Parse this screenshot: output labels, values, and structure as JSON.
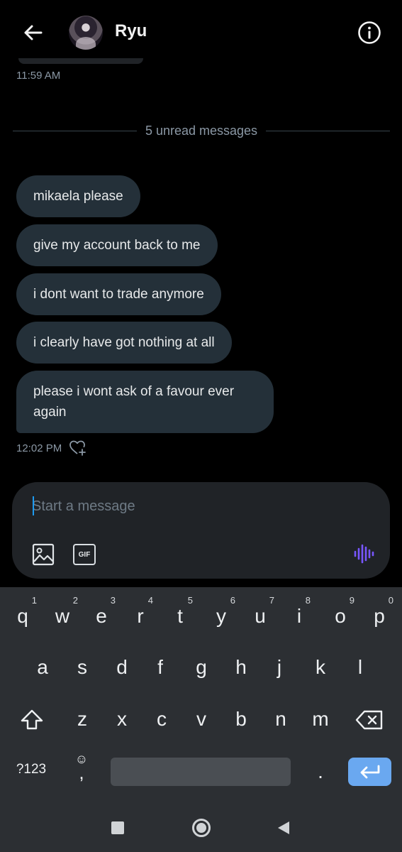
{
  "header": {
    "contact_name": "Ryu",
    "back_icon": "arrow-left-icon",
    "info_icon": "info-icon"
  },
  "conversation": {
    "previous_timestamp": "11:59 AM",
    "unread_divider": "5 unread messages",
    "messages": [
      "mikaela please",
      "give my account back to me",
      "i dont want to trade anymore",
      "i clearly have got nothing at all",
      "please i wont ask of a favour ever again"
    ],
    "last_timestamp": "12:02 PM"
  },
  "composer": {
    "placeholder": "Start a message",
    "gif_label": "GIF",
    "voice_color": "#7856ff"
  },
  "keyboard": {
    "row1": [
      {
        "key": "q",
        "hint": "1"
      },
      {
        "key": "w",
        "hint": "2"
      },
      {
        "key": "e",
        "hint": "3"
      },
      {
        "key": "r",
        "hint": "4"
      },
      {
        "key": "t",
        "hint": "5"
      },
      {
        "key": "y",
        "hint": "6"
      },
      {
        "key": "u",
        "hint": "7"
      },
      {
        "key": "i",
        "hint": "8"
      },
      {
        "key": "o",
        "hint": "9"
      },
      {
        "key": "p",
        "hint": "0"
      }
    ],
    "row2": [
      "a",
      "s",
      "d",
      "f",
      "g",
      "h",
      "j",
      "k",
      "l"
    ],
    "row3": [
      "z",
      "x",
      "c",
      "v",
      "b",
      "n",
      "m"
    ],
    "symbols_label": "?123",
    "emoji_key": "☺",
    "comma_key": ",",
    "period_key": ".",
    "enter_color": "#6aa8f0"
  },
  "colors": {
    "background": "#000000",
    "bubble": "#243039",
    "keyboard": "#2c2f33",
    "accent": "#1d9bf0"
  }
}
